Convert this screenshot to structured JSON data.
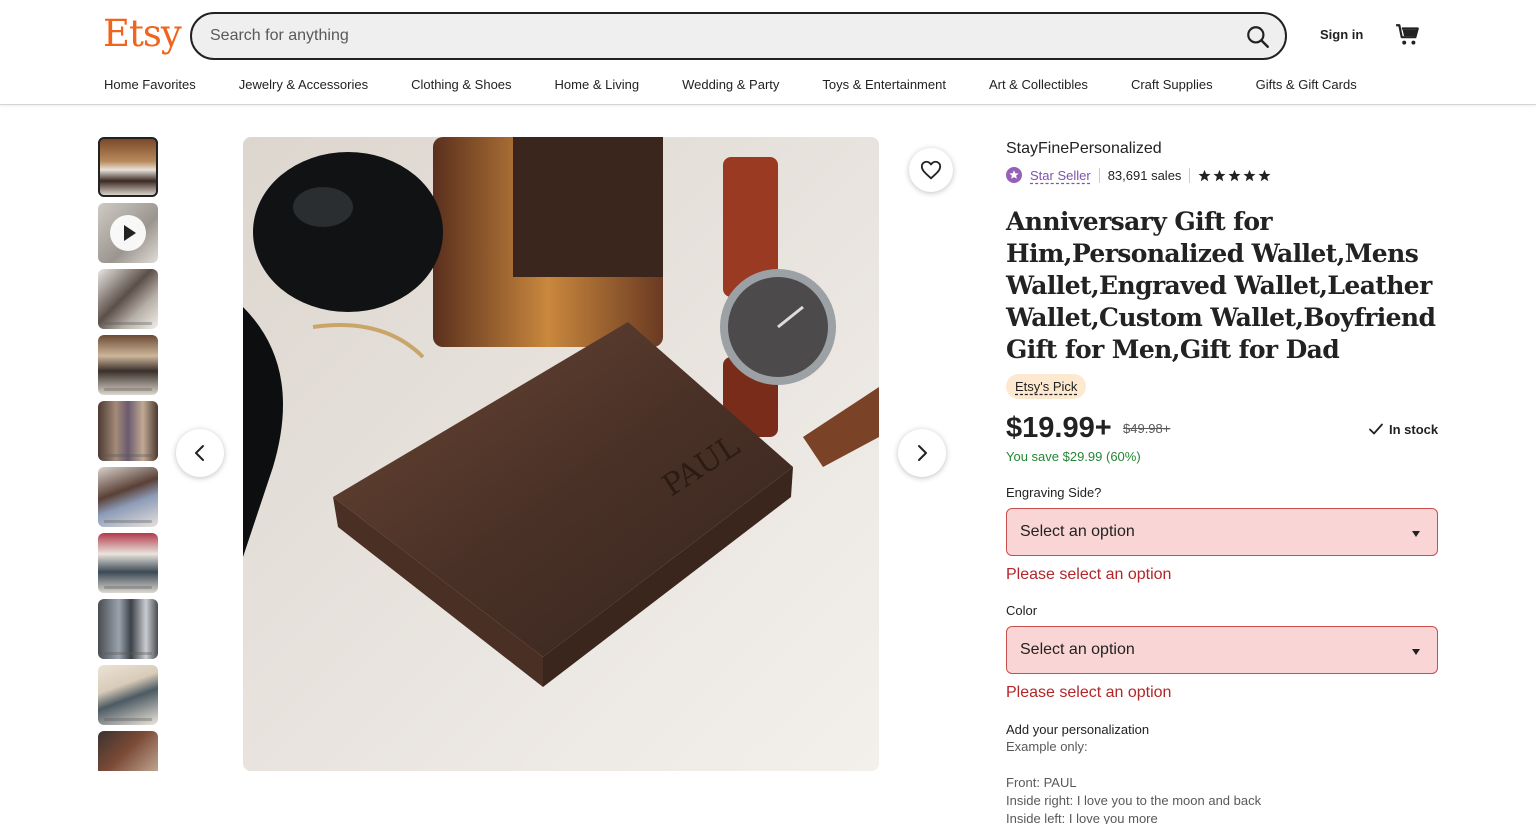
{
  "header": {
    "logo": "Etsy",
    "search_placeholder": "Search for anything",
    "sign_in": "Sign in",
    "categories": [
      "Home Favorites",
      "Jewelry & Accessories",
      "Clothing & Shoes",
      "Home & Living",
      "Wedding & Party",
      "Toys & Entertainment",
      "Art & Collectibles",
      "Craft Supplies",
      "Gifts & Gift Cards"
    ]
  },
  "gallery": {
    "thumbnail_count": 10
  },
  "listing": {
    "shop_name": "StayFinePersonalized",
    "star_seller": "Star Seller",
    "sales": "83,691 sales",
    "rating_stars": 5,
    "title": "Anniversary Gift for Him,Personalized Wallet,Mens Wallet,Engraved Wallet,Leather Wallet,Custom Wallet,Boyfriend Gift for Men,Gift for Dad",
    "badge": "Etsy's Pick",
    "price": "$19.99+",
    "original_price": "$49.98+",
    "stock_status": "In stock",
    "savings": "You save $29.99 (60%)"
  },
  "options": {
    "engraving_label": "Engraving Side?",
    "engraving_value": "Select an option",
    "engraving_error": "Please select an option",
    "color_label": "Color",
    "color_value": "Select an option",
    "color_error": "Please select an option"
  },
  "personalization": {
    "label": "Add your personalization",
    "line1": "Example only:",
    "line2": "Front: PAUL",
    "line3": "Inside right: I love you to the moon and back",
    "line4": "Inside left: I love you more"
  },
  "colors": {
    "brand": "#f1641e",
    "star_seller": "#7f53ac",
    "savings": "#258635",
    "error": "#b3262a",
    "error_bg": "#f9d5d5"
  }
}
